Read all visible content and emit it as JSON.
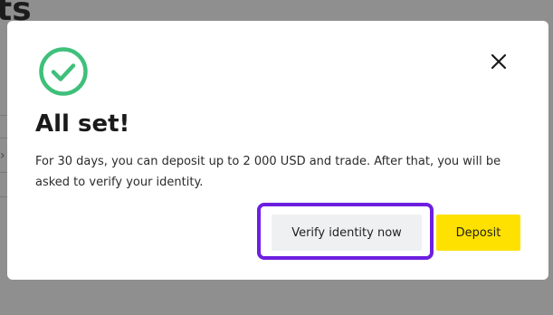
{
  "background": {
    "heading_fragment": "ts"
  },
  "modal": {
    "title": "All set!",
    "description": "For 30 days, you can deposit up to 2 000 USD and trade. After that, you will be asked to verify your identity.",
    "verify_button_label": "Verify identity now",
    "deposit_button_label": "Deposit",
    "success_icon": "check-circle-icon",
    "close_icon": "close-icon"
  },
  "colors": {
    "success": "#3fc07a",
    "primary_button": "#ffe100",
    "secondary_button": "#eef0f2",
    "highlight": "#6d1fe0",
    "overlay": "#8f8f8f"
  }
}
